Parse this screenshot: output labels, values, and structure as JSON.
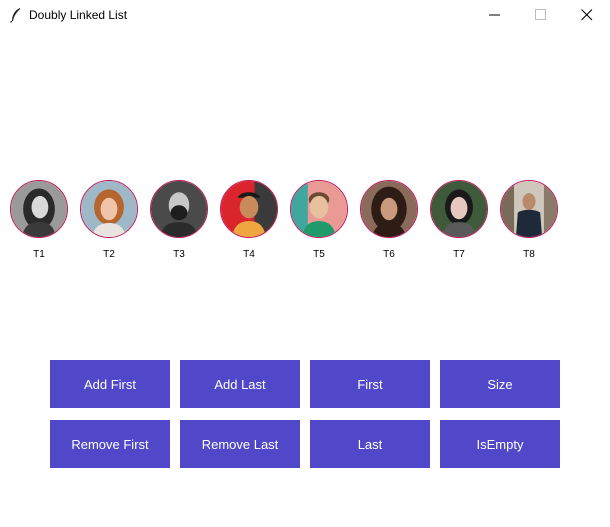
{
  "window": {
    "title": "Doubly Linked List",
    "app_icon": "feather-icon",
    "controls": [
      "minimize-icon",
      "maximize-icon",
      "close-icon"
    ]
  },
  "nodes": [
    {
      "label": "T1"
    },
    {
      "label": "T2"
    },
    {
      "label": "T3"
    },
    {
      "label": "T4"
    },
    {
      "label": "T5"
    },
    {
      "label": "T6"
    },
    {
      "label": "T7"
    },
    {
      "label": "T8"
    }
  ],
  "buttons": {
    "add_first": "Add First",
    "add_last": "Add Last",
    "first": "First",
    "size": "Size",
    "remove_first": "Remove First",
    "remove_last": "Remove Last",
    "last": "Last",
    "is_empty": "IsEmpty"
  },
  "colors": {
    "button_bg": "#5048c8",
    "button_text": "#ffffff",
    "avatar_border": "#c2185b"
  }
}
